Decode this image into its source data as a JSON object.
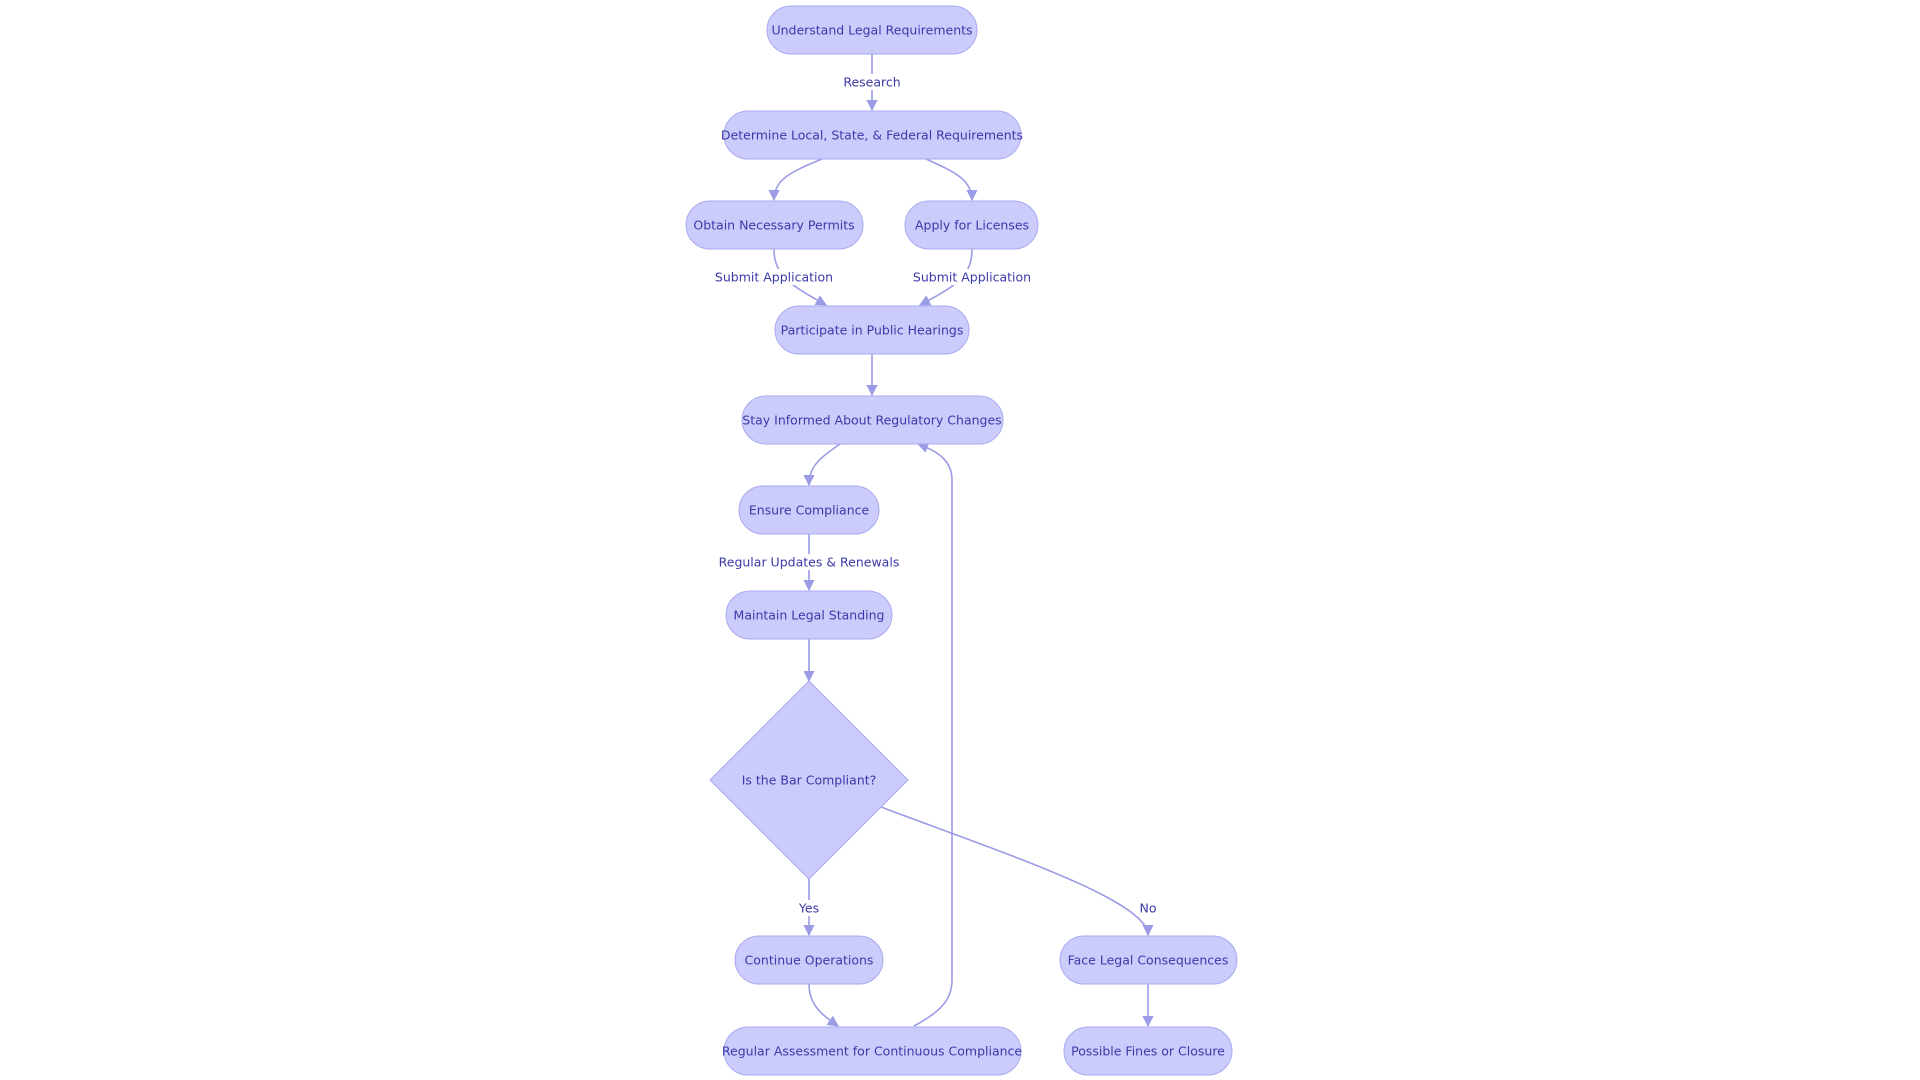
{
  "diagram": {
    "nodes": {
      "understand": "Understand Legal Requirements",
      "determine": "Determine Local, State, & Federal Requirements",
      "permits": "Obtain Necessary Permits",
      "licenses": "Apply for Licenses",
      "hearings": "Participate in Public Hearings",
      "stay_informed": "Stay Informed About Regulatory Changes",
      "ensure": "Ensure Compliance",
      "maintain": "Maintain Legal Standing",
      "decision": "Is the Bar Compliant?",
      "continue": "Continue Operations",
      "consequences": "Face Legal Consequences",
      "assessment": "Regular Assessment for Continuous Compliance",
      "fines": "Possible Fines or Closure"
    },
    "edge_labels": {
      "research": "Research",
      "submit_permits": "Submit Application",
      "submit_licenses": "Submit Application",
      "updates": "Regular Updates & Renewals",
      "yes": "Yes",
      "no": "No"
    },
    "colors": {
      "node_fill": "#cbcbfc",
      "node_stroke": "#aaaaf0",
      "text": "#3a3aa8",
      "edge": "#9b9be6"
    }
  }
}
